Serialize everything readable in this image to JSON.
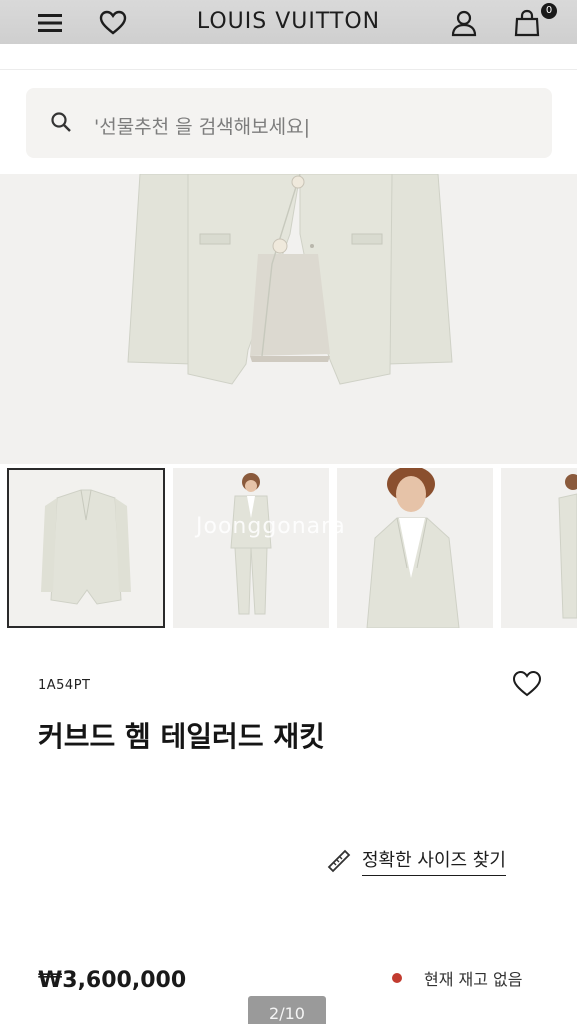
{
  "header": {
    "brand": "LOUIS VUITTON",
    "cart_count": "0",
    "icons": [
      "menu-icon",
      "heart-icon",
      "user-icon",
      "shopping-bag-icon"
    ]
  },
  "search": {
    "placeholder": "'선물추천 을 검색해보세요|"
  },
  "gallery": {
    "watermark": "Joonggonara",
    "active_index": 0,
    "thumbnails": [
      "jacket-flat",
      "model-full",
      "model-half",
      "model-side"
    ]
  },
  "product": {
    "sku": "1A54PT",
    "title": "커브드 헴 테일러드 재킷",
    "size_link": "정확한 사이즈 찾기",
    "price": "₩3,600,000",
    "stock_status": "현재 재고 없음"
  },
  "pager": {
    "label": "2/10"
  },
  "colors": {
    "accent": "#1a1a1a",
    "stock_dot": "#c23b2f",
    "jacket": "#e3e4da"
  }
}
